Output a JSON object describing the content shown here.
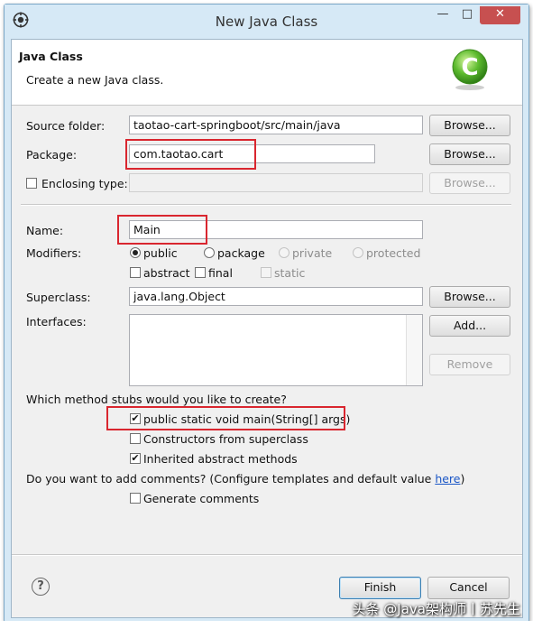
{
  "window": {
    "title": "New Java Class",
    "minimize": "—",
    "maximize": "□",
    "close": "✕"
  },
  "banner": {
    "title": "Java Class",
    "subtitle": "Create a new Java class.",
    "icon": "java-class-c-icon"
  },
  "source_folder": {
    "label": "Source folder:",
    "value": "taotao-cart-springboot/src/main/java",
    "browse": "Browse..."
  },
  "package": {
    "label": "Package:",
    "value": "com.taotao.cart",
    "browse": "Browse..."
  },
  "enclosing": {
    "label": "Enclosing type:",
    "value": "",
    "browse": "Browse...",
    "checked": false
  },
  "name": {
    "label": "Name:",
    "value": "Main"
  },
  "modifiers": {
    "label": "Modifiers:",
    "access": [
      "public",
      "package",
      "private",
      "protected"
    ],
    "selected": "public",
    "other": [
      "abstract",
      "final",
      "static"
    ]
  },
  "superclass": {
    "label": "Superclass:",
    "value": "java.lang.Object",
    "browse": "Browse..."
  },
  "interfaces": {
    "label": "Interfaces:",
    "add": "Add...",
    "remove": "Remove"
  },
  "stubs": {
    "question": "Which method stubs would you like to create?",
    "main": "public static void main(String[] args)",
    "constructors": "Constructors from superclass",
    "inherited": "Inherited abstract methods",
    "checked": {
      "main": true,
      "constructors": false,
      "inherited": true
    }
  },
  "comments": {
    "question": "Do you want to add comments? (Configure templates and default value ",
    "link": "here",
    "close_paren": ")",
    "generate": "Generate comments"
  },
  "footer": {
    "finish": "Finish",
    "cancel": "Cancel",
    "help": "?"
  },
  "watermark": "头条 @Java架构师丨苏先生",
  "colors": {
    "highlight": "#d9262f",
    "title_bar": "#d6e9f6",
    "close_button": "#c75050"
  }
}
